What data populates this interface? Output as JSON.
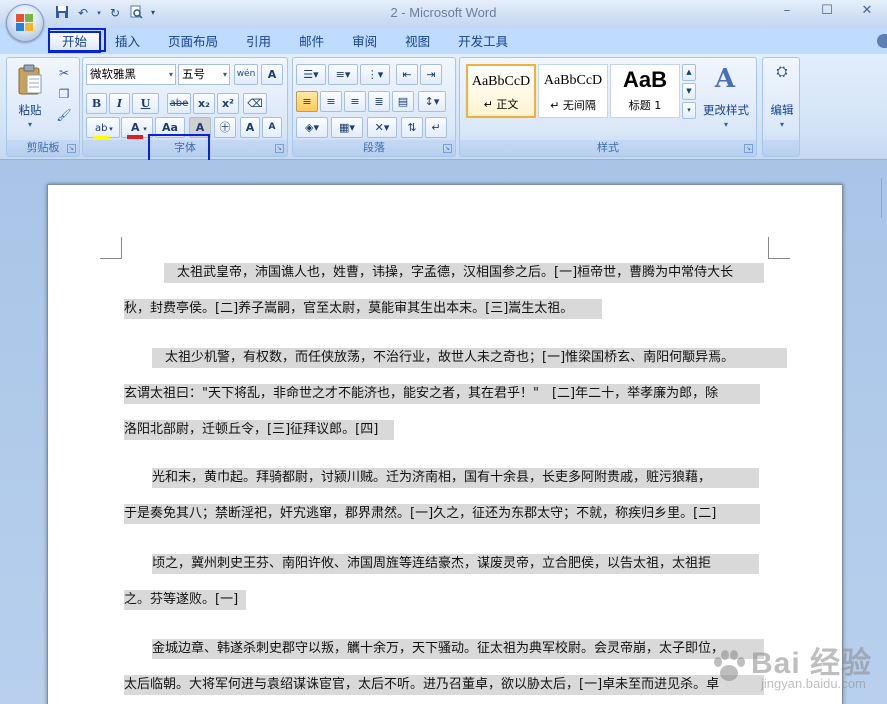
{
  "window": {
    "title": "2 - Microsoft Word",
    "controls": [
      "–",
      "☐",
      "✕"
    ]
  },
  "qat": {
    "icons": [
      "save-icon",
      "undo-icon",
      "redo-icon",
      "print-preview-icon",
      "customize-icon"
    ]
  },
  "tabs": [
    "开始",
    "插入",
    "页面布局",
    "引用",
    "邮件",
    "审阅",
    "视图",
    "开发工具"
  ],
  "active_tab": "开始",
  "ribbon": {
    "clipboard": {
      "label": "剪贴板",
      "paste": "粘贴"
    },
    "font": {
      "label": "字体",
      "font_name": "微软雅黑",
      "font_size": "五号",
      "bold": "B",
      "italic": "I",
      "underline": "U",
      "strike": "abe",
      "subscript": "x₂",
      "superscript": "x²",
      "grow": "A",
      "shrink": "A",
      "change_case": "Aa",
      "clear_format": "A"
    },
    "paragraph": {
      "label": "段落"
    },
    "styles": {
      "label": "样式",
      "items": [
        {
          "sample": "AaBbCcD",
          "name": "↵ 正文"
        },
        {
          "sample": "AaBbCcD",
          "name": "↵ 无间隔"
        },
        {
          "sample": "AaB",
          "name": "标题 1"
        }
      ],
      "change_styles": "更改样式"
    },
    "editing": {
      "label": "编辑"
    }
  },
  "document": {
    "paragraphs": [
      [
        "　太祖武皇帝，沛国谯人也，姓曹，讳操，字孟德，汉相国参之后。[一]桓帝世，曹腾为中常侍大长",
        "秋，封费亭侯。[二]养子嵩嗣，官至太尉，莫能审其生出本末。[三]嵩生太祖。"
      ],
      [
        "　太祖少机警，有权数，而任侠放荡，不治行业，故世人未之奇也；[一]惟梁国桥玄、南阳何颙异焉。",
        "玄谓太祖曰：\"天下将乱，非命世之才不能济也，能安之者，其在君乎！\"　[二]年二十，举孝廉为郎，除",
        "洛阳北部尉，迁顿丘令，[三]征拜议郎。[四]"
      ],
      [
        "光和末，黄巾起。拜骑都尉，讨颍川贼。迁为济南相，国有十余县，长吏多阿附贵戚，赃污狼藉，",
        "于是奏免其八；禁断淫祀，奸宄逃窜，郡界肃然。[一]久之，征还为东郡太守；不就，称疾归乡里。[二]"
      ],
      [
        "顷之，冀州刺史王芬、南阳许攸、沛国周旌等连结豪杰，谋废灵帝，立合肥侯，以告太祖，太祖拒",
        "之。芬等遂败。[一]"
      ],
      [
        "金城边章、韩遂杀刺史郡守以叛，觽十余万，天下骚动。征太祖为典军校尉。会灵帝崩，太子即位，",
        "太后临朝。大将军何进与袁绍谋诛宦官，太后不听。进乃召董卓，欲以胁太后，[一]卓未至而进见杀。卓"
      ]
    ]
  },
  "watermark": {
    "text": "Bai 经验",
    "sub": "jingyan.baidu.com"
  },
  "colors": {
    "highlight_border": "#0a22d6",
    "text_shading": "#d9d9d9"
  }
}
